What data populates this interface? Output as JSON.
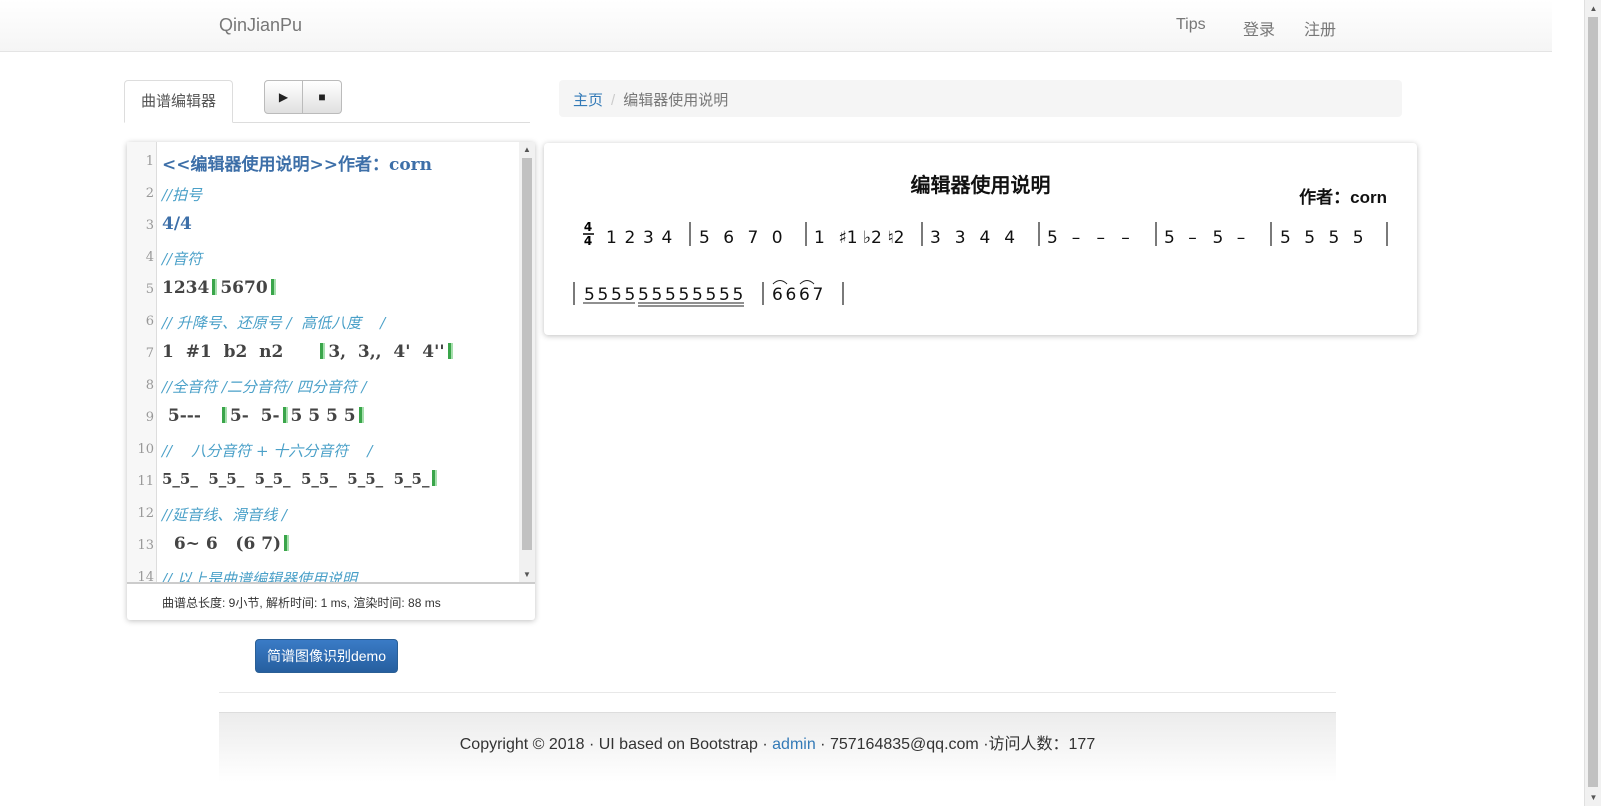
{
  "nav": {
    "brand": "QinJianPu",
    "links": [
      "Tips",
      "登录",
      "注册"
    ]
  },
  "editor_tab": {
    "label": "曲谱编辑器",
    "play_icon": "▶",
    "stop_icon": "■"
  },
  "editor": {
    "lines": [
      {
        "n": "1",
        "text": "<<编辑器使用说明>>作者：corn"
      },
      {
        "n": "2",
        "text": "//拍号"
      },
      {
        "n": "3",
        "text": "4/4"
      },
      {
        "n": "4",
        "text": "//音符"
      },
      {
        "n": "5",
        "text": "1234",
        "text2": "5670"
      },
      {
        "n": "6",
        "text": "// 升降号、还原号 /  高低八度    /"
      },
      {
        "n": "7",
        "text": "1  #1  b2  n2",
        "text2": "3,  3,,  4'  4''"
      },
      {
        "n": "8",
        "text": "//全音符 /二分音符/ 四分音符 /"
      },
      {
        "n": "9",
        "text": " 5---",
        "text2": "5-  5-",
        "text3": "5 5 5 5"
      },
      {
        "n": "10",
        "text": "//    八分音符 + 十六分音符    /"
      },
      {
        "n": "11",
        "text": "5_5_  5_5_  5_5_  5_5_  5_5_  5_5_"
      },
      {
        "n": "12",
        "text": "//延音线、滑音线 /"
      },
      {
        "n": "13",
        "text": "  6~ 6   (6 7)"
      },
      {
        "n": "14",
        "text": "// 以上是曲谱编辑器使用说明"
      }
    ],
    "status": "曲谱总长度: 9小节, 解析时间: 1 ms, 渲染时间: 88 ms"
  },
  "demo_button": "简谱图像识别demo",
  "breadcrumb": {
    "home": "主页",
    "sep": "/",
    "current": "编辑器使用说明"
  },
  "score": {
    "title": "编辑器使用说明",
    "author": "作者：corn",
    "time_sig": {
      "top": "4",
      "bottom": "4"
    },
    "row1_measures": [
      [
        "1",
        "2",
        "3",
        "4"
      ],
      [
        "5",
        "6",
        "7",
        "0"
      ],
      [
        "1",
        "♯1",
        "♭2",
        "♮2"
      ],
      [
        "3",
        "3",
        "4",
        "4"
      ],
      [
        "5",
        "–",
        "–",
        "–"
      ],
      [
        "5",
        "–",
        "5",
        "–"
      ],
      [
        "5",
        "5",
        "5",
        "5"
      ]
    ],
    "row2_measures": [
      [
        "5",
        "5",
        "5",
        "5",
        "5",
        "5",
        "5",
        "5",
        "5",
        "5",
        "5",
        "5"
      ],
      [
        "6",
        "6",
        "6",
        "7"
      ]
    ]
  },
  "footer": {
    "copyright": "Copyright © 2018 · UI based on Bootstrap · ",
    "admin": "admin",
    "contact": " · 757164835@qq.com ·访问人数：177"
  },
  "colors": {
    "link": "#337ab7",
    "comment": "#4aa0c8",
    "keyword": "#3d6fa8",
    "bar": "#3aa54a"
  }
}
